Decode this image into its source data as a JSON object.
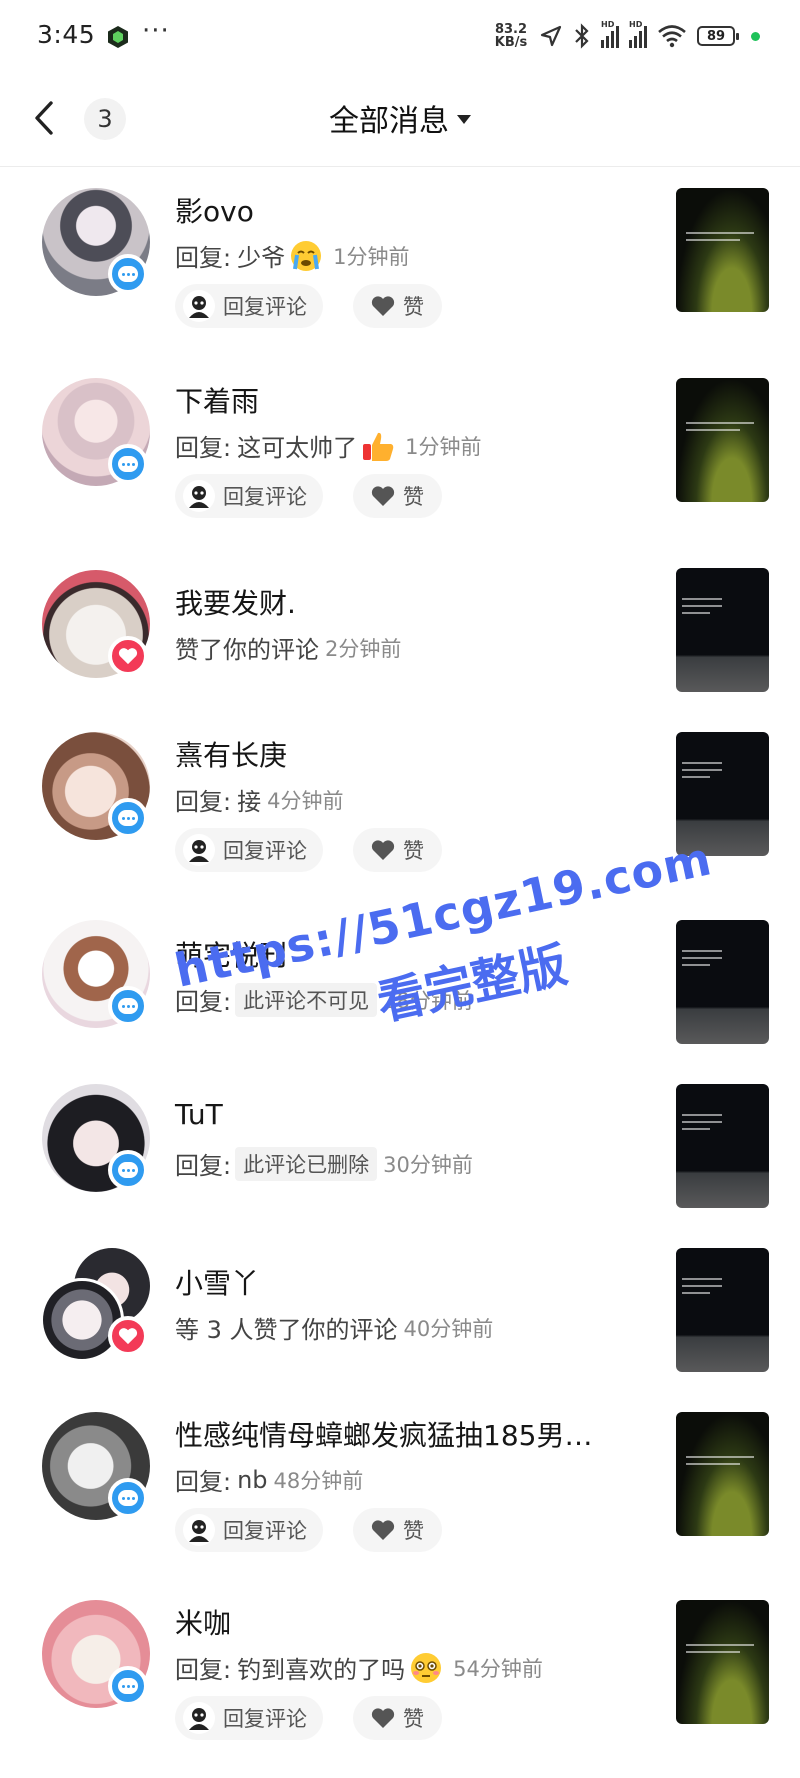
{
  "status": {
    "time": "3:45",
    "dots": "···",
    "speed_value": "83.2",
    "speed_unit": "KB/s",
    "hd1": "HD",
    "hd2": "HD",
    "battery": "89"
  },
  "header": {
    "back_icon": "chevron-left-icon",
    "count": "3",
    "title": "全部消息",
    "dropdown_icon": "caret-down-icon"
  },
  "colors": {
    "blue_badge": "#2f9bf0",
    "red_badge": "#f33a57",
    "watermark": "#4b6cf0"
  },
  "messages": [
    {
      "name": "影ovo",
      "prefix": "回复:",
      "text": "少爷",
      "emoji": "crying-emoji",
      "time": "1分钟前",
      "badge": "comment-icon",
      "reply_label": "回复评论",
      "like_label": "赞"
    },
    {
      "name": "下着雨",
      "prefix": "回复:",
      "text": "这可太帅了",
      "emoji": "thumbs-up-emoji",
      "time": "1分钟前",
      "badge": "comment-icon",
      "reply_label": "回复评论",
      "like_label": "赞"
    },
    {
      "name": "我要发财.",
      "text": "赞了你的评论",
      "time": "2分钟前",
      "badge": "heart-icon"
    },
    {
      "name": "熹有长庚",
      "prefix": "回复:",
      "text": "接",
      "time": "4分钟前",
      "badge": "comment-icon",
      "reply_label": "回复评论",
      "like_label": "赞"
    },
    {
      "name": "萌宅悦刊",
      "prefix": "回复:",
      "quoted": "此评论不可见",
      "time": "28分钟前",
      "badge": "comment-icon"
    },
    {
      "name": "TuT",
      "prefix": "回复:",
      "quoted": "此评论已删除",
      "time": "30分钟前",
      "badge": "comment-icon"
    },
    {
      "name": "小雪丫",
      "text": "等 3 人赞了你的评论",
      "time": "40分钟前",
      "badge": "heart-icon"
    },
    {
      "name": "性感纯情母蟑螂发疯猛抽185男…",
      "prefix": "回复:",
      "text": "nb",
      "time": "48分钟前",
      "badge": "comment-icon",
      "reply_label": "回复评论",
      "like_label": "赞"
    },
    {
      "name": "米咖",
      "prefix": "回复:",
      "text": "钓到喜欢的了吗",
      "emoji": "flushed-emoji",
      "time": "54分钟前",
      "badge": "comment-icon",
      "reply_label": "回复评论",
      "like_label": "赞"
    }
  ],
  "watermark": {
    "url": "https://51cgz19.com",
    "caption": "看完整版"
  }
}
